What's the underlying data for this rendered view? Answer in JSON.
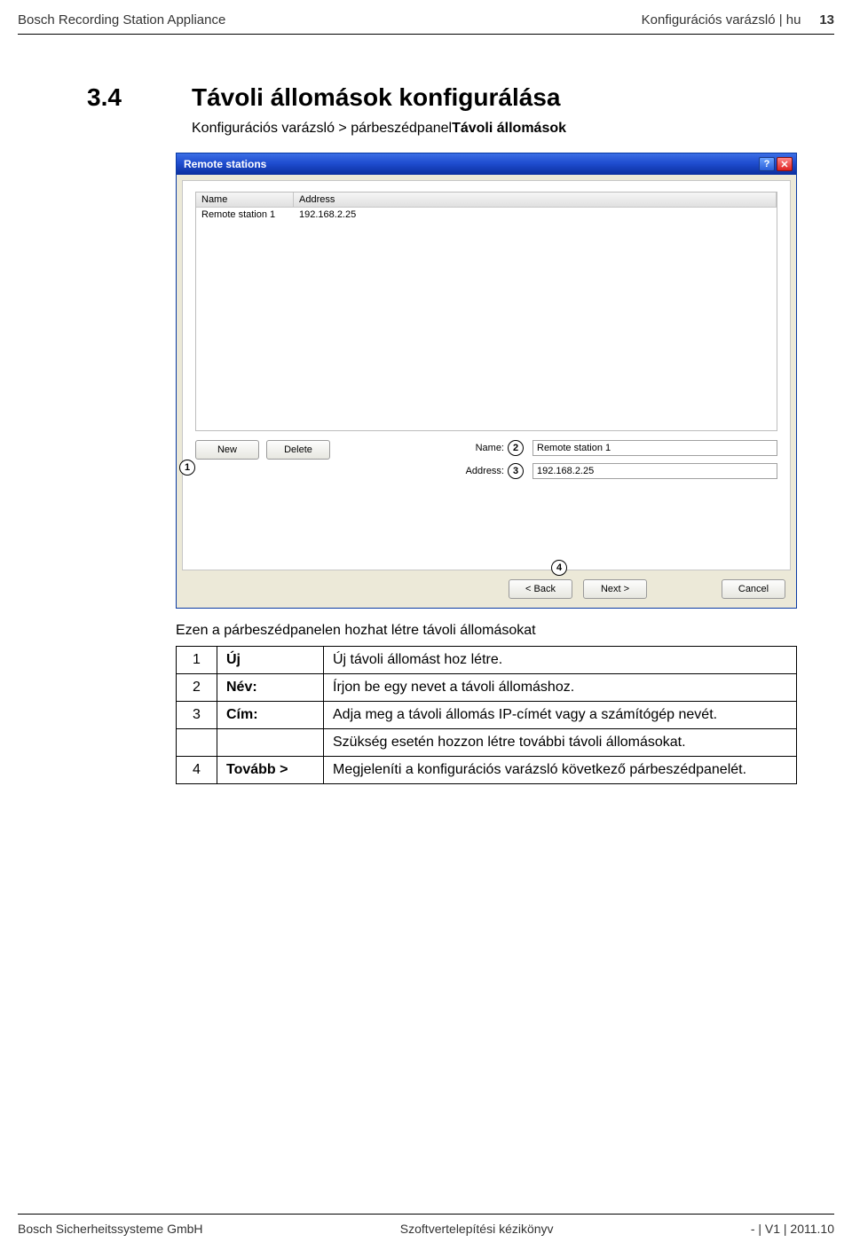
{
  "header": {
    "left": "Bosch Recording Station Appliance",
    "right": "Konfigurációs varázsló | hu",
    "page": "13"
  },
  "section": {
    "num": "3.4",
    "title": "Távoli állomások konfigurálása"
  },
  "breadcrumb": {
    "prefix": "Konfigurációs varázsló > párbeszédpanel",
    "boldpart": "Távoli állomások"
  },
  "dialog": {
    "title": "Remote stations",
    "help_glyph": "?",
    "close_glyph": "✕",
    "columns": {
      "name": "Name",
      "address": "Address"
    },
    "rows": [
      {
        "name": "Remote station 1",
        "address": "192.168.2.25"
      }
    ],
    "buttons": {
      "new": "New",
      "delete": "Delete"
    },
    "form": {
      "name_label": "Name:",
      "name_value": "Remote station 1",
      "addr_label": "Address:",
      "addr_value": "192.168.2.25"
    },
    "wizard": {
      "back": "< Back",
      "next": "Next >",
      "cancel": "Cancel"
    }
  },
  "callouts": {
    "c1": "1",
    "c2": "2",
    "c3": "3",
    "c4": "4"
  },
  "subhead": "Ezen a párbeszédpanelen hozhat létre távoli állomásokat",
  "table": {
    "r1": {
      "n": "1",
      "label": "Új",
      "desc": "Új távoli állomást hoz létre."
    },
    "r2": {
      "n": "2",
      "label": "Név:",
      "desc": "Írjon be egy nevet a távoli állomáshoz."
    },
    "r3": {
      "n": "3",
      "label": "Cím:",
      "desc": "Adja meg a távoli állomás IP-címét vagy a számítógép nevét."
    },
    "r3b": {
      "desc": "Szükség esetén hozzon létre további távoli állomásokat."
    },
    "r4": {
      "n": "4",
      "label": "Tovább >",
      "desc": "Megjeleníti a konfigurációs varázsló következő párbeszédpanelét."
    }
  },
  "footer": {
    "left": "Bosch Sicherheitssysteme GmbH",
    "center": "Szoftvertelepítési kézikönyv",
    "right": "- | V1 | 2011.10"
  }
}
